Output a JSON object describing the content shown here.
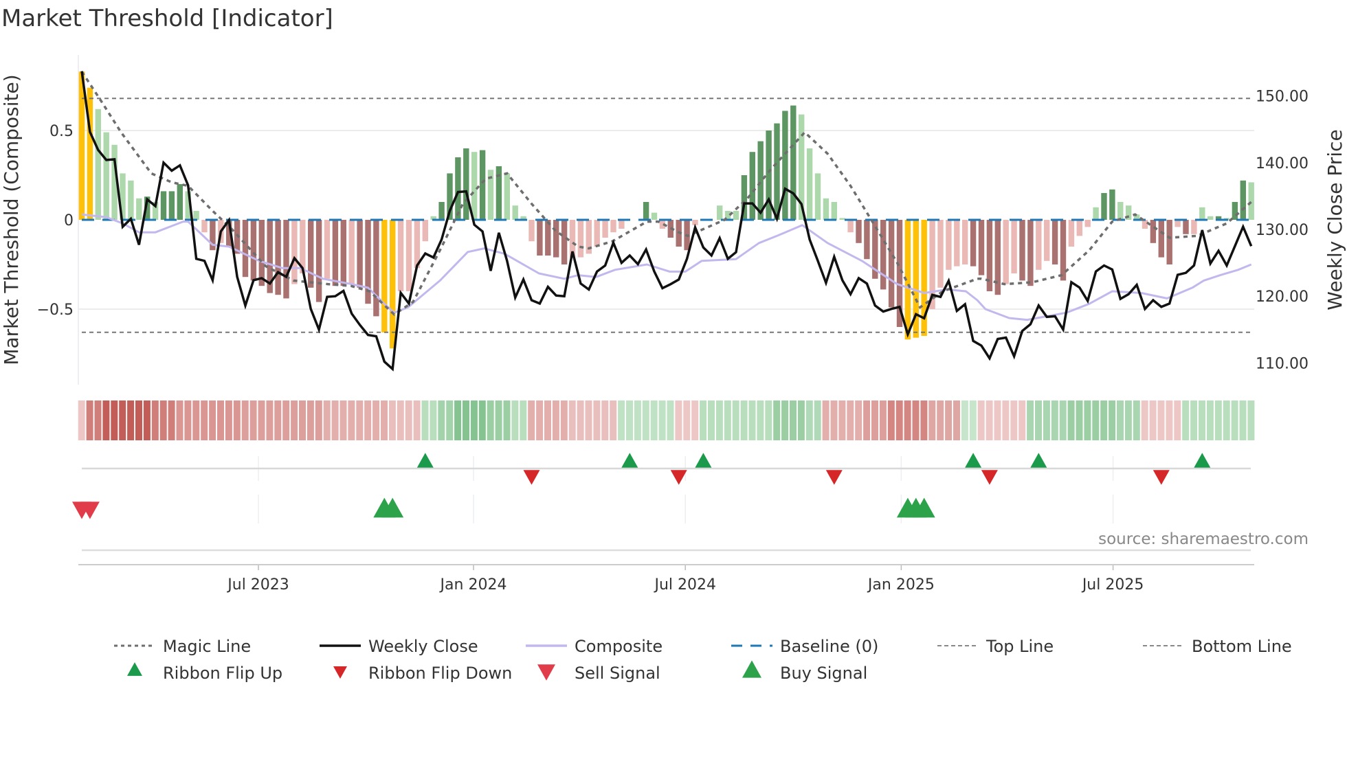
{
  "title": "Market Threshold [Indicator]",
  "source": "source: sharemaestro.com",
  "colors": {
    "extreme": "#FFC107",
    "strong_up": "#5e9663",
    "weak_up": "#acd8ac",
    "strong_down": "#a9716f",
    "weak_down": "#eab9b6",
    "close": "#111111",
    "composite": "#c3b8ee",
    "magic": "#6e6e6e",
    "baseline": "#1f77b4",
    "flip_up": "#1a9a4a",
    "flip_down": "#d62728",
    "sell": "#e03c4a",
    "buy": "#2ca24a"
  },
  "chart_data": {
    "type": "bar+line",
    "title": "Market Threshold [Indicator]",
    "ylabel_left": "Market Threshold (Composite)",
    "ylabel_right": "Weekly Close Price",
    "ylim_left": [
      -0.9,
      0.9
    ],
    "ylim_right": [
      104,
      156
    ],
    "left_ticks": [
      {
        "v": 0.5,
        "label": "0.5"
      },
      {
        "v": 0,
        "label": "0"
      },
      {
        "v": -0.5,
        "label": "−0.5"
      }
    ],
    "right_ticks": [
      {
        "v": 150,
        "label": "150.00"
      },
      {
        "v": 140,
        "label": "140.00"
      },
      {
        "v": 130,
        "label": "130.00"
      },
      {
        "v": 120,
        "label": "120.00"
      },
      {
        "v": 110,
        "label": "110.00"
      }
    ],
    "x_ticks": [
      {
        "week": 22.6,
        "label": "Jul 2023"
      },
      {
        "week": 48.9,
        "label": "Jan 2024"
      },
      {
        "week": 74.8,
        "label": "Jul 2024"
      },
      {
        "week": 101.2,
        "label": "Jan 2025"
      },
      {
        "week": 127.1,
        "label": "Jul 2025"
      }
    ],
    "weeks": 144,
    "top_line": 0.68,
    "bottom_line": -0.63,
    "baseline": 0,
    "bars": [
      0.83,
      0.74,
      0.62,
      0.49,
      0.42,
      0.26,
      0.22,
      0.12,
      0.13,
      0.1,
      0.16,
      0.16,
      0.2,
      0.16,
      0.05,
      -0.07,
      -0.17,
      -0.13,
      -0.15,
      -0.19,
      -0.32,
      -0.34,
      -0.37,
      -0.41,
      -0.42,
      -0.44,
      -0.36,
      -0.3,
      -0.38,
      -0.46,
      -0.33,
      -0.37,
      -0.37,
      -0.36,
      -0.38,
      -0.47,
      -0.54,
      -0.63,
      -0.72,
      -0.4,
      -0.4,
      -0.27,
      -0.12,
      0.02,
      0.1,
      0.26,
      0.35,
      0.4,
      0.38,
      0.39,
      0.28,
      0.3,
      0.26,
      0.08,
      0.02,
      -0.12,
      -0.2,
      -0.2,
      -0.21,
      -0.25,
      -0.21,
      -0.21,
      -0.19,
      -0.15,
      -0.1,
      -0.07,
      -0.05,
      0,
      0,
      0.1,
      0.04,
      -0.05,
      -0.1,
      -0.15,
      -0.17,
      -0.03,
      0,
      0,
      0.08,
      0.05,
      0.05,
      0.25,
      0.38,
      0.44,
      0.5,
      0.54,
      0.61,
      0.64,
      0.59,
      0.4,
      0.26,
      0.12,
      0.1,
      0.01,
      -0.07,
      -0.13,
      -0.22,
      -0.33,
      -0.39,
      -0.49,
      -0.6,
      -0.67,
      -0.66,
      -0.65,
      -0.5,
      -0.38,
      -0.28,
      -0.26,
      -0.25,
      -0.26,
      -0.31,
      -0.4,
      -0.42,
      -0.36,
      -0.3,
      -0.34,
      -0.37,
      -0.28,
      -0.23,
      -0.25,
      -0.34,
      -0.15,
      -0.09,
      -0.04,
      0.07,
      0.15,
      0.17,
      0.1,
      0.08,
      0.03,
      -0.05,
      -0.13,
      -0.21,
      -0.25,
      -0.04,
      -0.08,
      -0.08,
      0.07,
      0.02,
      0.02,
      0.01,
      0.1,
      0.22,
      0.21
    ],
    "bar_class": [
      "Y",
      "Y",
      "LG",
      "LG",
      "LG",
      "LG",
      "LG",
      "LG",
      "DG",
      "LG",
      "DG",
      "DG",
      "DG",
      "LG",
      "LG",
      "LR",
      "DR",
      "LR",
      "DR",
      "DR",
      "DR",
      "DR",
      "DR",
      "DR",
      "DR",
      "DR",
      "LR",
      "LR",
      "DR",
      "DR",
      "LR",
      "DR",
      "DR",
      "LR",
      "DR",
      "DR",
      "DR",
      "Y",
      "Y",
      "LR",
      "LR",
      "LR",
      "LR",
      "LG",
      "DG",
      "DG",
      "DG",
      "DG",
      "LG",
      "DG",
      "LG",
      "DG",
      "LG",
      "LG",
      "LG",
      "LR",
      "DR",
      "DR",
      "DR",
      "DR",
      "LR",
      "LR",
      "LR",
      "LR",
      "LR",
      "LR",
      "LR",
      "LR",
      "LR",
      "DG",
      "LG",
      "LR",
      "DR",
      "DR",
      "DR",
      "LR",
      "LG",
      "LG",
      "LG",
      "LG",
      "LG",
      "DG",
      "DG",
      "DG",
      "DG",
      "DG",
      "DG",
      "DG",
      "LG",
      "LG",
      "LG",
      "LG",
      "LG",
      "LG",
      "LR",
      "DR",
      "DR",
      "DR",
      "DR",
      "DR",
      "DR",
      "Y",
      "Y",
      "Y",
      "LR",
      "LR",
      "LR",
      "LR",
      "LR",
      "DR",
      "DR",
      "DR",
      "DR",
      "LR",
      "LR",
      "DR",
      "DR",
      "LR",
      "LR",
      "DR",
      "DR",
      "LR",
      "LR",
      "LR",
      "LG",
      "DG",
      "DG",
      "LG",
      "LG",
      "LG",
      "LR",
      "DR",
      "DR",
      "DR",
      "LR",
      "DR",
      "LR",
      "LG",
      "LG",
      "DG",
      "LG",
      "DG",
      "DG",
      "LG"
    ],
    "weekly_close": [
      153.7,
      144.6,
      141.9,
      140.4,
      140.5,
      130.4,
      131.6,
      127.7,
      134.5,
      133.5,
      140.0,
      138.8,
      139.6,
      136.6,
      125.6,
      125.3,
      122.4,
      129.7,
      131.4,
      122.9,
      118.6,
      122.4,
      122.7,
      121.9,
      123.6,
      122.9,
      125.7,
      124.2,
      118.1,
      115.0,
      119.9,
      120.0,
      120.8,
      117.4,
      115.7,
      114.2,
      114.0,
      110.2,
      109.1,
      120.5,
      118.9,
      124.6,
      126.4,
      125.8,
      128.5,
      132.8,
      135.6,
      135.7,
      130.7,
      129.7,
      123.8,
      129.5,
      125.3,
      119.8,
      122.5,
      119.4,
      118.9,
      121.4,
      120.1,
      120.0,
      126.7,
      121.9,
      121.0,
      123.7,
      124.6,
      128.0,
      125.0,
      126.1,
      124.8,
      127.0,
      123.7,
      121.2,
      121.8,
      122.5,
      125.6,
      130.3,
      127.3,
      126.1,
      128.7,
      125.6,
      126.6,
      133.9,
      133.9,
      132.5,
      134.5,
      131.6,
      136.1,
      135.4,
      133.8,
      128.5,
      125.3,
      122.0,
      125.9,
      122.4,
      120.3,
      122.7,
      121.9,
      118.6,
      117.7,
      118.1,
      118.4,
      114.3,
      117.3,
      116.7,
      120.2,
      119.9,
      122.3,
      117.8,
      118.8,
      113.3,
      112.6,
      110.7,
      113.6,
      113.8,
      111.0,
      114.8,
      115.8,
      118.6,
      116.9,
      117.0,
      115.0,
      122.1,
      121.3,
      119.3,
      123.7,
      124.6,
      124.0,
      119.6,
      120.3,
      121.7,
      118.1,
      119.4,
      118.4,
      118.9,
      123.2,
      123.5,
      124.6,
      129.9,
      124.9,
      126.8,
      124.6,
      127.5,
      130.4,
      127.5
    ],
    "composite": [
      [
        1,
        0.03
      ],
      [
        4,
        0.015
      ],
      [
        6,
        -0.02
      ],
      [
        8,
        -0.07
      ],
      [
        10,
        -0.07
      ],
      [
        13.4,
        -0.01
      ],
      [
        14,
        -0.01
      ],
      [
        17,
        -0.14
      ],
      [
        19,
        -0.15
      ],
      [
        22.7,
        -0.23
      ],
      [
        25.5,
        -0.27
      ],
      [
        27.7,
        -0.27
      ],
      [
        30.5,
        -0.33
      ],
      [
        34,
        -0.36
      ],
      [
        36,
        -0.38
      ],
      [
        38,
        -0.47
      ],
      [
        39.2,
        -0.52
      ],
      [
        40.9,
        -0.49
      ],
      [
        44.8,
        -0.34
      ],
      [
        48.2,
        -0.18
      ],
      [
        50.2,
        -0.16
      ],
      [
        52.7,
        -0.19
      ],
      [
        56.9,
        -0.3
      ],
      [
        60,
        -0.33
      ],
      [
        61.7,
        -0.31
      ],
      [
        63.9,
        -0.32
      ],
      [
        66.2,
        -0.28
      ],
      [
        70.1,
        -0.25
      ],
      [
        72.9,
        -0.29
      ],
      [
        74.8,
        -0.29
      ],
      [
        76.8,
        -0.23
      ],
      [
        81,
        -0.22
      ],
      [
        83.8,
        -0.13
      ],
      [
        86,
        -0.09
      ],
      [
        89.1,
        -0.03
      ],
      [
        92.2,
        -0.13
      ],
      [
        96.4,
        -0.23
      ],
      [
        100.7,
        -0.36
      ],
      [
        104,
        -0.41
      ],
      [
        106.8,
        -0.39
      ],
      [
        109.1,
        -0.4
      ],
      [
        110.5,
        -0.45
      ],
      [
        111.5,
        -0.5
      ],
      [
        114.4,
        -0.55
      ],
      [
        116.6,
        -0.56
      ],
      [
        121.4,
        -0.52
      ],
      [
        124.2,
        -0.47
      ],
      [
        127,
        -0.4
      ],
      [
        130.6,
        -0.41
      ],
      [
        133.7,
        -0.44
      ],
      [
        136.8,
        -0.38
      ],
      [
        138.2,
        -0.34
      ],
      [
        140.2,
        -0.31
      ],
      [
        142.4,
        -0.28
      ],
      [
        144,
        -0.25
      ]
    ],
    "magic_line": [
      [
        1,
        0.83
      ],
      [
        3.3,
        0.67
      ],
      [
        5.8,
        0.49
      ],
      [
        9.5,
        0.26
      ],
      [
        12,
        0.21
      ],
      [
        14,
        0.19
      ],
      [
        17,
        0.05
      ],
      [
        19.3,
        -0.05
      ],
      [
        23.5,
        -0.26
      ],
      [
        26.9,
        -0.34
      ],
      [
        31.1,
        -0.36
      ],
      [
        33.9,
        -0.37
      ],
      [
        36.2,
        -0.4
      ],
      [
        39.2,
        -0.53
      ],
      [
        41.5,
        -0.46
      ],
      [
        44.8,
        -0.17
      ],
      [
        47.6,
        0.09
      ],
      [
        50.4,
        0.23
      ],
      [
        53,
        0.26
      ],
      [
        56,
        0.09
      ],
      [
        58.9,
        -0.06
      ],
      [
        61.7,
        -0.15
      ],
      [
        63,
        -0.16
      ],
      [
        65.9,
        -0.12
      ],
      [
        70.1,
        -0.01
      ],
      [
        71.5,
        -0.01
      ],
      [
        74,
        -0.07
      ],
      [
        75.1,
        -0.09
      ],
      [
        79.6,
        0
      ],
      [
        82.4,
        0.12
      ],
      [
        85.2,
        0.28
      ],
      [
        89.4,
        0.49
      ],
      [
        92.2,
        0.37
      ],
      [
        95,
        0.19
      ],
      [
        97.8,
        -0.02
      ],
      [
        100.7,
        -0.24
      ],
      [
        103.5,
        -0.49
      ],
      [
        106.3,
        -0.4
      ],
      [
        110.5,
        -0.33
      ],
      [
        111,
        -0.33
      ],
      [
        113.8,
        -0.36
      ],
      [
        117.2,
        -0.35
      ],
      [
        120.8,
        -0.31
      ],
      [
        124.2,
        -0.17
      ],
      [
        127,
        -0.01
      ],
      [
        129.8,
        0.03
      ],
      [
        134,
        -0.1
      ],
      [
        137.4,
        -0.09
      ],
      [
        141,
        -0.02
      ],
      [
        144,
        0.1
      ]
    ],
    "ribbon": [
      -0.15,
      -0.6,
      -0.6,
      -0.8,
      -0.8,
      -0.8,
      -0.8,
      -0.8,
      -0.8,
      -0.6,
      -0.6,
      -0.6,
      -0.45,
      -0.45,
      -0.45,
      -0.45,
      -0.45,
      -0.45,
      -0.45,
      -0.45,
      -0.4,
      -0.4,
      -0.4,
      -0.4,
      -0.4,
      -0.4,
      -0.4,
      -0.4,
      -0.4,
      -0.4,
      -0.3,
      -0.3,
      -0.3,
      -0.3,
      -0.3,
      -0.3,
      -0.3,
      -0.3,
      -0.2,
      -0.2,
      -0.2,
      -0.2,
      0.25,
      0.25,
      0.4,
      0.4,
      0.6,
      0.6,
      0.6,
      0.6,
      0.45,
      0.45,
      0.45,
      0.25,
      0.25,
      -0.3,
      -0.3,
      -0.3,
      -0.3,
      -0.3,
      -0.2,
      -0.2,
      -0.2,
      -0.2,
      -0.2,
      -0.2,
      0.2,
      0.2,
      0.2,
      0.2,
      0.2,
      0.2,
      0.2,
      -0.15,
      -0.15,
      -0.15,
      0.25,
      0.25,
      0.25,
      0.25,
      0.25,
      0.25,
      0.25,
      0.25,
      0.25,
      0.45,
      0.45,
      0.45,
      0.45,
      0.3,
      0.3,
      -0.3,
      -0.3,
      -0.3,
      -0.3,
      -0.3,
      -0.4,
      -0.4,
      -0.4,
      -0.55,
      -0.55,
      -0.55,
      -0.55,
      -0.55,
      -0.35,
      -0.35,
      -0.35,
      -0.35,
      0.15,
      0.15,
      -0.15,
      -0.15,
      -0.15,
      -0.15,
      -0.15,
      -0.15,
      0.35,
      0.35,
      0.35,
      0.35,
      0.35,
      0.45,
      0.45,
      0.45,
      0.45,
      0.45,
      0.45,
      0.35,
      0.35,
      0.35,
      -0.15,
      -0.15,
      -0.15,
      -0.15,
      -0.15,
      0.25,
      0.25,
      0.25,
      0.25,
      0.25,
      0.25,
      0.25,
      0.25,
      0.25
    ],
    "ribbon_flip_up": [
      43,
      68,
      77,
      110,
      118,
      138
    ],
    "ribbon_flip_down": [
      56,
      74,
      93,
      112,
      133
    ],
    "sell_signals": [
      1,
      2
    ],
    "buy_signals": [
      38,
      39,
      102,
      103,
      104
    ]
  },
  "legend": [
    {
      "key": "magic",
      "label": "Magic Line"
    },
    {
      "key": "close",
      "label": "Weekly Close"
    },
    {
      "key": "composite",
      "label": "Composite"
    },
    {
      "key": "baseline",
      "label": "Baseline (0)"
    },
    {
      "key": "top",
      "label": "Top Line"
    },
    {
      "key": "bottom",
      "label": "Bottom Line"
    },
    {
      "key": "flip_up",
      "label": "Ribbon Flip Up"
    },
    {
      "key": "flip_down",
      "label": "Ribbon Flip Down"
    },
    {
      "key": "sell",
      "label": "Sell Signal"
    },
    {
      "key": "buy",
      "label": "Buy Signal"
    }
  ]
}
